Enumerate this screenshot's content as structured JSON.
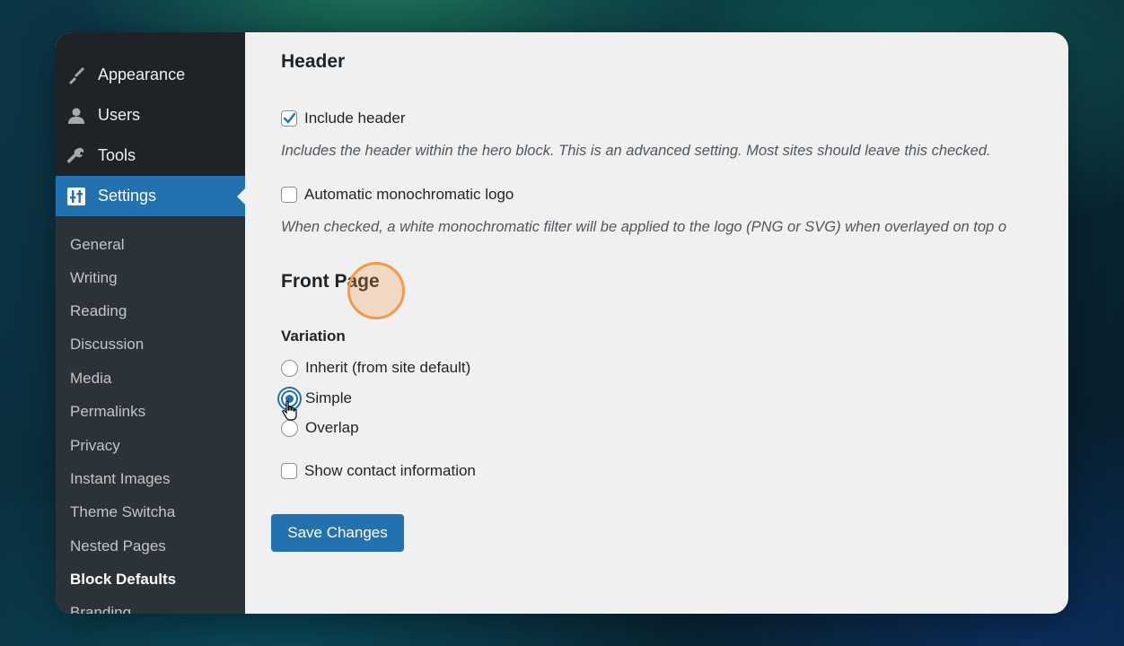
{
  "sidebar": {
    "top_items": [
      {
        "label": "Appearance",
        "icon": "paintbrush-icon"
      },
      {
        "label": "Users",
        "icon": "user-icon"
      },
      {
        "label": "Tools",
        "icon": "wrench-icon"
      },
      {
        "label": "Settings",
        "icon": "settings-icon",
        "active": true
      }
    ],
    "submenu": [
      "General",
      "Writing",
      "Reading",
      "Discussion",
      "Media",
      "Permalinks",
      "Privacy",
      "Instant Images",
      "Theme Switcha",
      "Nested Pages",
      "Block Defaults",
      "Branding"
    ],
    "current_submenu": "Block Defaults"
  },
  "main": {
    "header_section": {
      "title": "Header",
      "include_header": {
        "label": "Include header",
        "checked": true
      },
      "include_header_desc": "Includes the header within the hero block. This is an advanced setting. Most sites should leave this checked.",
      "mono_logo": {
        "label": "Automatic monochromatic logo",
        "checked": false
      },
      "mono_logo_desc": "When checked, a white monochromatic filter will be applied to the logo (PNG or SVG) when overlayed on top o"
    },
    "front_page_section": {
      "title": "Front Page",
      "variation_label": "Variation",
      "options": [
        {
          "label": "Inherit (from site default)",
          "checked": false
        },
        {
          "label": "Simple",
          "checked": true
        },
        {
          "label": "Overlap",
          "checked": false
        }
      ],
      "show_contact": {
        "label": "Show contact information",
        "checked": false
      }
    },
    "save_label": "Save Changes"
  },
  "colors": {
    "accent": "#2271b1",
    "sidebar_bg": "#1d2327",
    "submenu_bg": "#2c3338",
    "content_bg": "#f0f0f1",
    "click_highlight": "#f2994a"
  }
}
